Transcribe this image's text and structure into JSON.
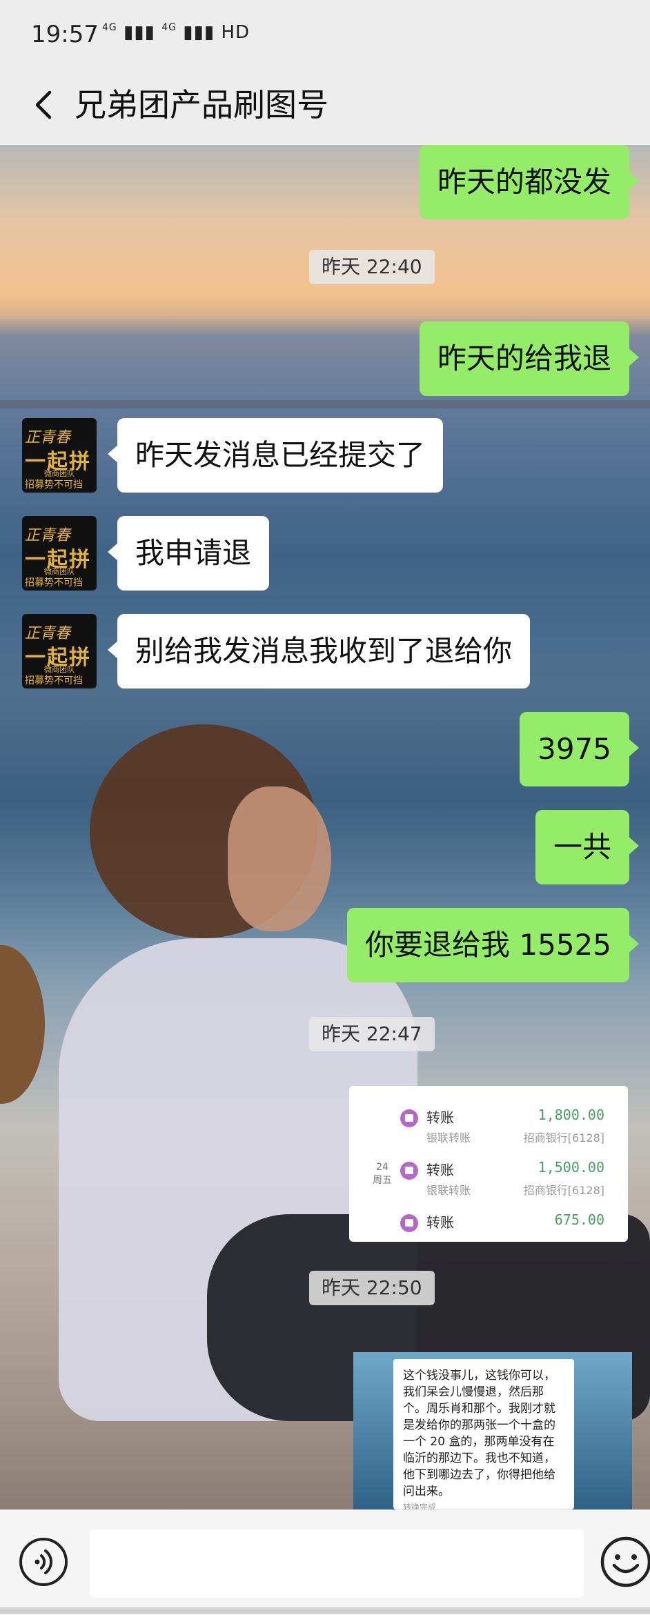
{
  "status_bar": {
    "time": "19:57",
    "network": "4G",
    "network2": "4G",
    "hd": "HD"
  },
  "header": {
    "title": "兄弟团产品刷图号"
  },
  "avatar": {
    "line1": "正青春",
    "line2": "一起拼",
    "line3": "微商团队",
    "line4": "招募势不可挡"
  },
  "messages": [
    {
      "type": "out",
      "text": "昨天的都没发"
    },
    {
      "type": "time",
      "text": "昨天 22:40"
    },
    {
      "type": "out",
      "text": "昨天的给我退"
    },
    {
      "type": "in",
      "text": "昨天发消息已经提交了"
    },
    {
      "type": "in",
      "text": "我申请退"
    },
    {
      "type": "in",
      "text": "别给我发消息我收到了退给你"
    },
    {
      "type": "out",
      "text": "3975"
    },
    {
      "type": "out",
      "text": "一共"
    },
    {
      "type": "out",
      "text": "你要退给我 15525"
    },
    {
      "type": "time",
      "text": "昨天 22:47"
    },
    {
      "type": "time",
      "text": "昨天 22:50"
    }
  ],
  "transfers": {
    "date_day": "24",
    "date_week": "周五",
    "items": [
      {
        "title": "转账",
        "sub": "银联转账",
        "amount": "1,800.00",
        "bank": "招商银行[6128]"
      },
      {
        "title": "转账",
        "sub": "银联转账",
        "amount": "1,500.00",
        "bank": "招商银行[6128]"
      },
      {
        "title": "转账",
        "sub": "",
        "amount": "675.00",
        "bank": ""
      }
    ]
  },
  "chat_screenshot": {
    "text": "这个钱没事儿，这钱你可以，我们呆会儿慢慢退，然后那个。周乐肖和那个。我刚才就是发给你的那两张一个十盒的一个 20 盒的，那两单没有在临沂的那边下。我也不知道，他下到哪边去了，你得把他给问出来。",
    "footer": "转换完成"
  },
  "bottom_bar": {
    "input_value": ""
  },
  "colors": {
    "out_bubble": "#95ec69",
    "in_bubble": "#ffffff",
    "header_bg": "#ededed"
  }
}
